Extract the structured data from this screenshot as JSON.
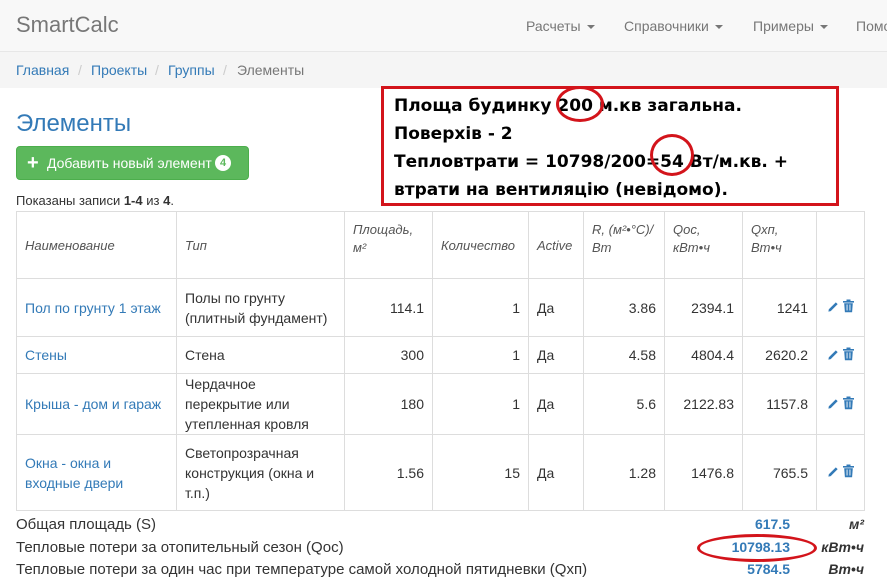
{
  "navbar": {
    "brand": "SmartCalc",
    "menu": [
      "Расчеты",
      "Справочники",
      "Примеры",
      "Помо"
    ]
  },
  "breadcrumb": [
    "Главная",
    "Проекты",
    "Группы",
    "Элементы"
  ],
  "page_title": "Элементы",
  "add_button": {
    "label": "Добавить новый элемент",
    "count": "4"
  },
  "summary": {
    "prefix": "Показаны записи ",
    "range": "1-4",
    "middle": " из ",
    "total": "4",
    "suffix": "."
  },
  "table": {
    "headers": [
      "Наименование",
      "Тип",
      "Площадь, м²",
      "Количество",
      "Active",
      "R, (м²•°С)/ Вт",
      "Qос, кВт•ч",
      "Qхп, Вт•ч"
    ],
    "rows": [
      {
        "name": "Пол по грунту 1 этаж",
        "type": "Полы по грунту (плитный фундамент)",
        "area": "114.1",
        "qty": "1",
        "active": "Да",
        "r": "3.86",
        "qos": "2394.1",
        "qhp": "1241"
      },
      {
        "name": "Стены",
        "type": "Стена",
        "area": "300",
        "qty": "1",
        "active": "Да",
        "r": "4.58",
        "qos": "4804.4",
        "qhp": "2620.2"
      },
      {
        "name": "Крыша - дом и гараж",
        "type": "Чердачное перекрытие или утепленная кровля",
        "area": "180",
        "qty": "1",
        "active": "Да",
        "r": "5.6",
        "qos": "2122.83",
        "qhp": "1157.8"
      },
      {
        "name": "Окна - окна и входные двери",
        "type": "Светопрозрачная конструкция (окна и т.п.)",
        "area": "1.56",
        "qty": "15",
        "active": "Да",
        "r": "1.28",
        "qos": "1476.8",
        "qhp": "765.5"
      }
    ],
    "action_icons": [
      "pencil-icon",
      "trash-icon"
    ]
  },
  "totals": [
    {
      "label": "Общая площадь (S)",
      "value": "617.5",
      "unit": "м²"
    },
    {
      "label": "Тепловые потери за отопительный сезон (Qос)",
      "value": "10798.13",
      "unit": "кВт•ч"
    },
    {
      "label": "Тепловые потери за один час при температуре самой холодной пятидневки (Qхп)",
      "value": "5784.5",
      "unit": "Вт•ч"
    }
  ],
  "annotation": {
    "lines": [
      "Площа будинку 200 м.кв загальна.",
      "Поверхів - 2",
      "Тепловтрати = 10798/200=54 Вт/м.кв. +",
      "втрати на вентиляцію (невідомо)."
    ],
    "color": "#d3141b"
  },
  "colors": {
    "link": "#337ab7",
    "success": "#5cb85c",
    "annotation": "#d3141b"
  }
}
